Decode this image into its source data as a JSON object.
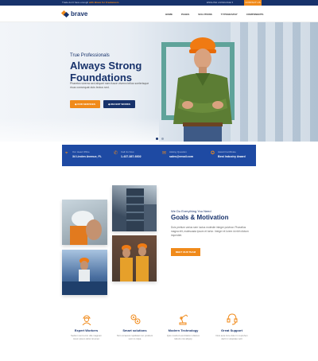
{
  "topbar": {
    "message_prefix": "Trade don't have enough",
    "message_link": "with Brave for Freelancers",
    "language": "ENGLISH LANGUAGE ▾",
    "contact_label": "CONTACT US"
  },
  "header": {
    "brand": "brave",
    "nav": [
      "HOME",
      "PAGES",
      "SOLUTIONS",
      "TYPOGRAPHY",
      "COMPONENTS"
    ]
  },
  "hero": {
    "eyebrow": "True Professionals",
    "title": "Always Strong Foundations",
    "lead": "Pharetra viverra sed aliquet nam fusce viverra tellus scelerisque risus consequat duis lectus sed.",
    "primary_button": "OUR SERVICES",
    "secondary_button": "RECENT WORKS",
    "slide_count": 2,
    "active_slide": 1
  },
  "infobar": {
    "items": [
      {
        "icon": "map-pin-icon",
        "key": "Our Head Office",
        "value": "34 Linden Avenue, FL"
      },
      {
        "icon": "phone-icon",
        "key": "Call Us Now",
        "value": "1-437-387-6602"
      },
      {
        "icon": "mail-icon",
        "key": "Asking Question",
        "value": "sales@email.com"
      },
      {
        "icon": "award-icon",
        "key": "Award Certificate",
        "value": "Best Industry Award"
      }
    ]
  },
  "about": {
    "eyebrow": "We Do Everything You Need",
    "title": "Goals & Motivation",
    "text": "Duis pretium varius sem luctus molestie integer pulvinar. Phasellus magna elit, malesuada ipsum et tortor. Integer et lorem id nibh dictum imperdiet.",
    "button": "MEET OUR TEAM"
  },
  "services": [
    {
      "icon": "engineer-icon",
      "title": "Expert Workers",
      "desc": "Sedium sunt error ulla magnam lorem ipsum dolor sit amet"
    },
    {
      "icon": "gears-icon",
      "title": "Smart solutions",
      "desc": "Sint occaecat cupidatat non proident sunt in culpa"
    },
    {
      "icon": "robot-arm-icon",
      "title": "Modern Technology",
      "desc": "Quis nostrud exercitation ullamco laboris nisi aliquip"
    },
    {
      "icon": "headset-icon",
      "title": "Great Support",
      "desc": "Duis aute irure dolor in reprehen derit in voluptate velit"
    }
  ],
  "colors": {
    "navy": "#17326b",
    "orange": "#f08a1a",
    "blue": "#1e4aa3",
    "teal": "#5fa39a"
  }
}
